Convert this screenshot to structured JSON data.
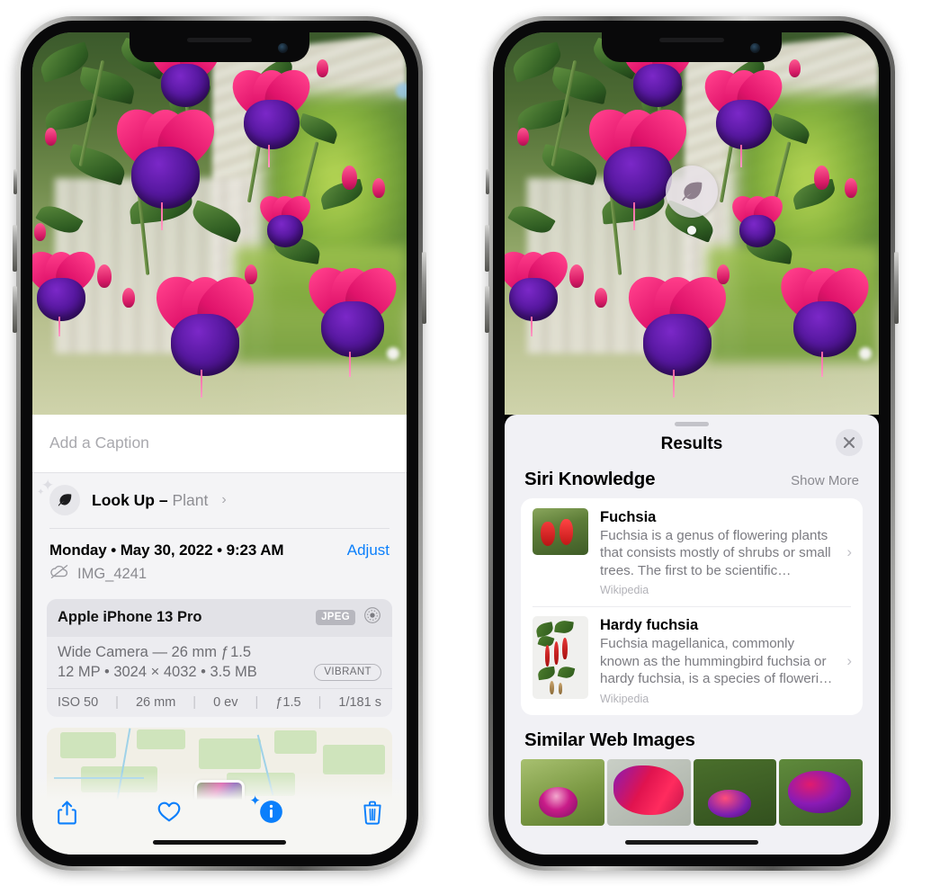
{
  "left_phone": {
    "photo": {
      "alt": "fuchsia-plant-photo",
      "subject": "Fuchsia flowers hanging basket"
    },
    "caption": {
      "placeholder": "Add a Caption",
      "value": ""
    },
    "lookup_row": {
      "icon": "leaf-icon",
      "sparkle_icon": "sparkle-icon",
      "label": "Look Up – ",
      "subject": "Plant",
      "chevron": "›"
    },
    "date_row": {
      "date_text": "Monday • May 30, 2022 • 9:23 AM",
      "adjust_label": "Adjust",
      "cloud_icon": "cloud-slash-icon",
      "file_name": "IMG_4241"
    },
    "exif": {
      "device": "Apple iPhone 13 Pro",
      "format_badge": "JPEG",
      "raw_icon": "live-photo-icon",
      "lens": "Wide Camera — 26 mm ƒ 1.5",
      "specs": "12 MP • 3024 × 4032 • 3.5 MB",
      "vibrant_badge": "VIBRANT",
      "footer": [
        "ISO 50",
        "26 mm",
        "0 ev",
        "ƒ1.5",
        "1/181 s"
      ],
      "separator": "|"
    },
    "map": {
      "name": "location-map-thumbnail",
      "pin": "photo-pin"
    },
    "toolbar": {
      "share": "share-icon",
      "favorite": "heart-icon",
      "info": "info-sparkle-icon",
      "delete": "trash-icon",
      "accent_color": "#0b7ffb"
    }
  },
  "right_phone": {
    "photo_badge": {
      "icon": "leaf-icon",
      "name": "look-up-badge"
    },
    "sheet": {
      "title": "Results",
      "close_icon": "close-icon",
      "grabber": "sheet-grabber"
    },
    "siri_knowledge": {
      "section_title": "Siri Knowledge",
      "action_label": "Show More",
      "cards": [
        {
          "title": "Fuchsia",
          "description": "Fuchsia is a genus of flowering plants that consists mostly of shrubs or small trees. The first to be scientific…",
          "source": "Wikipedia",
          "thumb": "fuchsia-red-flowers-thumb",
          "chevron": "›"
        },
        {
          "title": "Hardy fuchsia",
          "description": "Fuchsia magellanica, commonly known as the hummingbird fuchsia or hardy fuchsia, is a species of floweri…",
          "source": "Wikipedia",
          "thumb": "hardy-fuchsia-branch-thumb",
          "chevron": "›"
        }
      ]
    },
    "similar_web_images": {
      "section_title": "Similar Web Images",
      "images": [
        {
          "name": "similar-image-1"
        },
        {
          "name": "similar-image-2"
        },
        {
          "name": "similar-image-3"
        },
        {
          "name": "similar-image-4"
        }
      ]
    }
  },
  "colors": {
    "ios_blue": "#0b7ffb",
    "sheet_bg": "#f1f1f5",
    "card_bg": "#ffffff",
    "secondary_text": "#8e8e93"
  }
}
